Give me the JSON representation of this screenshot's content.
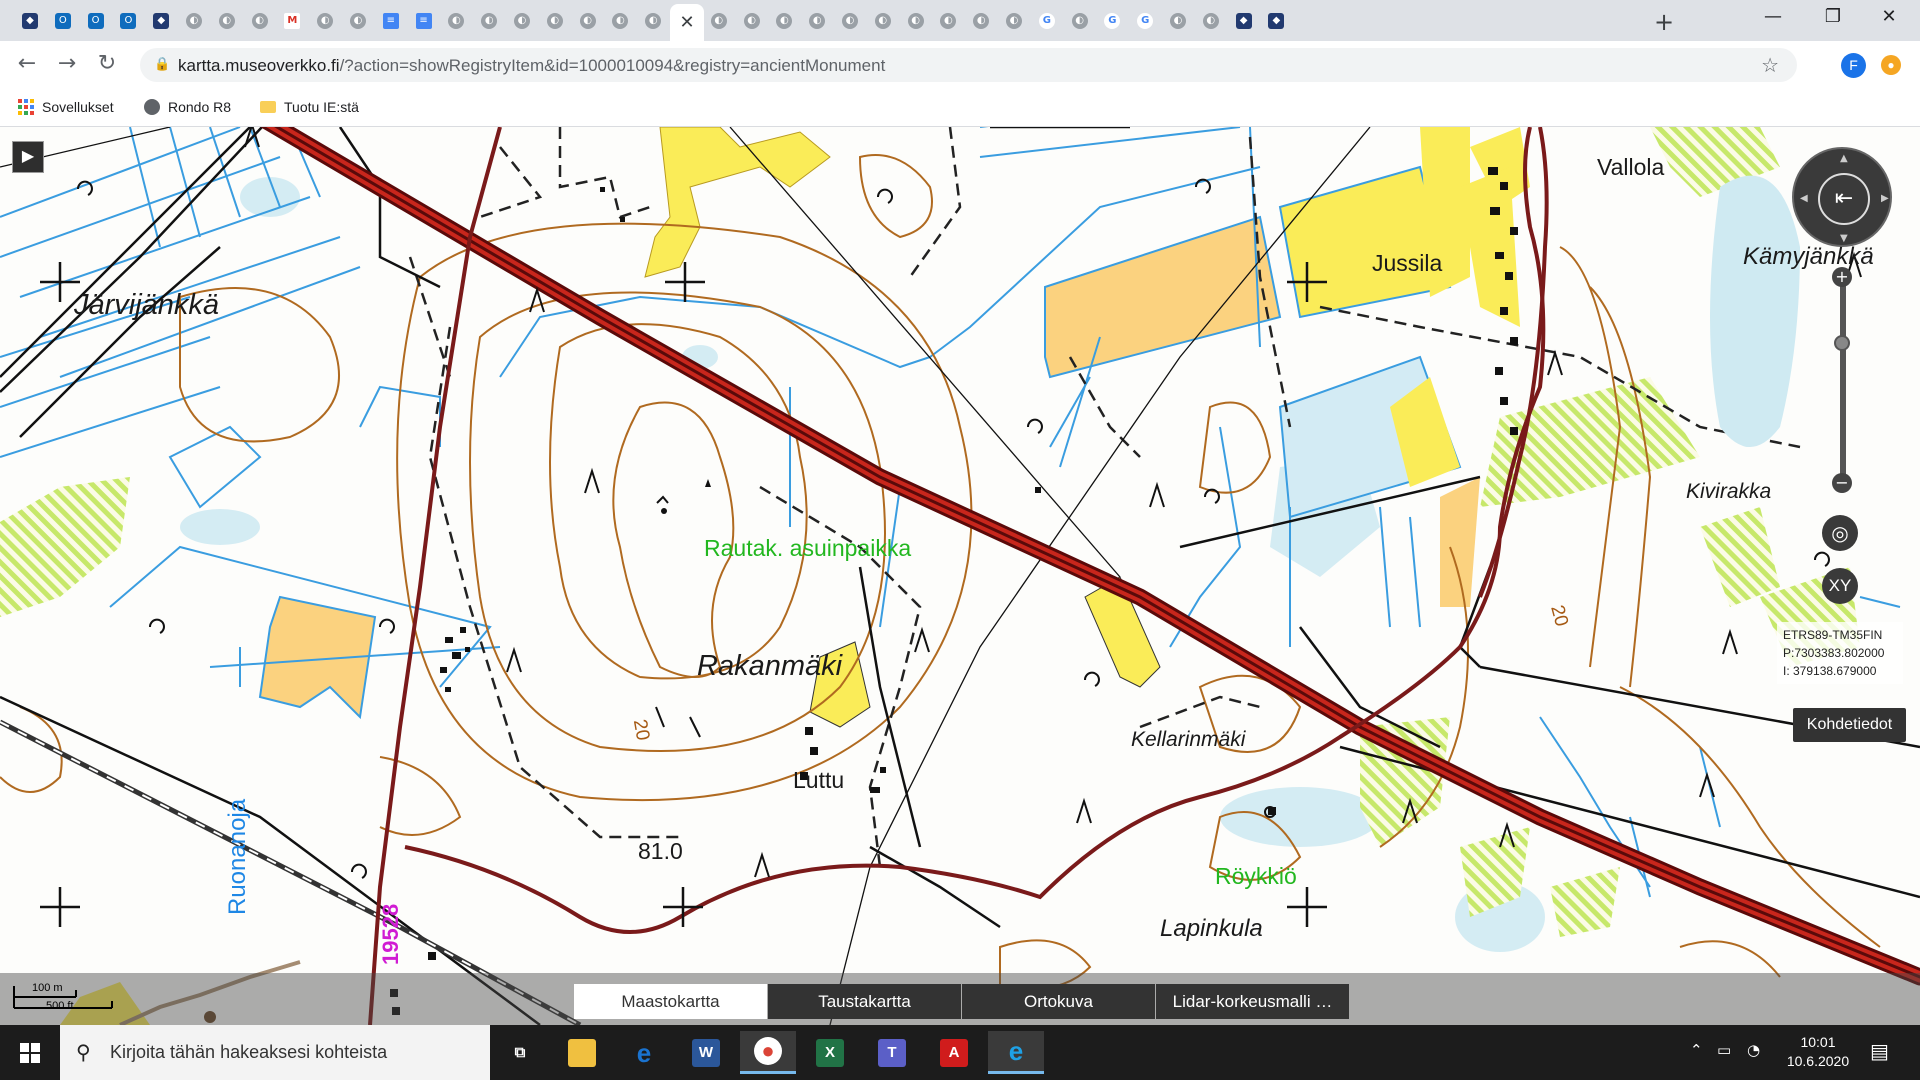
{
  "browser": {
    "tabs": [
      {
        "icon": "shield-icon",
        "type": "shield"
      },
      {
        "icon": "outlook-icon",
        "type": "outlook"
      },
      {
        "icon": "outlook-icon",
        "type": "outlook"
      },
      {
        "icon": "outlook-icon",
        "type": "outlook"
      },
      {
        "icon": "shield-icon",
        "type": "shield"
      },
      {
        "icon": "page-icon",
        "type": "sep"
      },
      {
        "icon": "page-icon",
        "type": "sep"
      },
      {
        "icon": "page-icon",
        "type": "sep"
      },
      {
        "icon": "gmail-icon",
        "type": "gmail"
      },
      {
        "icon": "page-icon",
        "type": "sep"
      },
      {
        "icon": "page-icon",
        "type": "sep"
      },
      {
        "icon": "docs-icon",
        "type": "docs"
      },
      {
        "icon": "docs-icon",
        "type": "docs"
      },
      {
        "icon": "page-icon",
        "type": "sep"
      },
      {
        "icon": "page-icon",
        "type": "sep"
      },
      {
        "icon": "page-icon",
        "type": "sep"
      },
      {
        "icon": "page-icon",
        "type": "sep"
      },
      {
        "icon": "page-icon",
        "type": "sep"
      },
      {
        "icon": "page-icon",
        "type": "sep"
      },
      {
        "icon": "page-icon",
        "type": "sep"
      },
      {
        "icon": "close-icon",
        "type": "active"
      },
      {
        "icon": "page-icon",
        "type": "sep"
      },
      {
        "icon": "page-icon",
        "type": "sep"
      },
      {
        "icon": "page-icon",
        "type": "sep"
      },
      {
        "icon": "page-icon",
        "type": "sep"
      },
      {
        "icon": "page-icon",
        "type": "sep"
      },
      {
        "icon": "page-icon",
        "type": "sep"
      },
      {
        "icon": "page-icon",
        "type": "sep"
      },
      {
        "icon": "page-icon",
        "type": "sep"
      },
      {
        "icon": "page-icon",
        "type": "sep"
      },
      {
        "icon": "page-icon",
        "type": "sep"
      },
      {
        "icon": "google-icon",
        "type": "google"
      },
      {
        "icon": "page-icon",
        "type": "sep"
      },
      {
        "icon": "google-icon",
        "type": "google"
      },
      {
        "icon": "google-icon",
        "type": "google"
      },
      {
        "icon": "mail-icon",
        "type": "sep"
      },
      {
        "icon": "chart-icon",
        "type": "sep"
      },
      {
        "icon": "shield-icon",
        "type": "shield"
      },
      {
        "icon": "shield-icon",
        "type": "shield"
      }
    ],
    "new_tab": "+",
    "window_controls": {
      "minimize": "—",
      "maximize": "❐",
      "close": "✕"
    },
    "url_host": "kartta.museoverkko.fi",
    "url_rest": "/?action=showRegistryItem&id=1000010094&registry=ancientMonument",
    "profile_initial": "F",
    "bookmarks": [
      {
        "label": "Sovellukset",
        "icon": "apps-icon"
      },
      {
        "label": "Rondo R8",
        "icon": "globe-icon"
      },
      {
        "label": "Tuotu IE:stä",
        "icon": "folder-icon"
      }
    ]
  },
  "map": {
    "place_names": {
      "jarvijankka": "Järvijänkkä",
      "rakanmaki": "Rakanmäki",
      "jussila": "Jussila",
      "vallola": "Vallola",
      "kamyjankka": "Kämyjänkkä",
      "kivirakka": "Kivirakka",
      "kellarinmaki": "Kellarinmäki",
      "lapinkula": "Lapinkula",
      "luttu": "Luttu"
    },
    "monument_label": "Rautak. asuinpaikka",
    "roykkio_label": "Röykkiö",
    "water_label": "Ruonanoja",
    "road_number": "19528",
    "elevation": "81.0",
    "contour_labels": [
      "20",
      "20"
    ],
    "controls": {
      "play": "▶",
      "compass": "⇤",
      "zoom_in": "+",
      "zoom_out": "−",
      "locate": "◎",
      "xy": "XY",
      "feature_info": "Kohdetiedot"
    },
    "coordinates": {
      "system": "ETRS89-TM35FIN",
      "north": "P:7303383.802000",
      "east": "I:   379138.679000"
    },
    "scale": {
      "top": "100 m",
      "bottom": "500 ft"
    },
    "layer_tabs": [
      {
        "label": "Maastokartta",
        "active": true
      },
      {
        "label": "Taustakartta",
        "active": false
      },
      {
        "label": "Ortokuva",
        "active": false
      },
      {
        "label": "Lidar-korkeusmalli …",
        "active": false
      }
    ]
  },
  "taskbar": {
    "search_placeholder": "Kirjoita tähän hakeaksesi kohteista",
    "apps": [
      {
        "name": "task-view-icon",
        "glyph": "⧉",
        "color": "transparent"
      },
      {
        "name": "file-explorer-icon",
        "glyph": "▬",
        "color": "#f0c040"
      },
      {
        "name": "edge-icon",
        "glyph": "e",
        "color": "#1a73d0"
      },
      {
        "name": "word-icon",
        "glyph": "W",
        "color": "#2b579a"
      },
      {
        "name": "chrome-icon",
        "glyph": "●",
        "color": "#db4437"
      },
      {
        "name": "excel-icon",
        "glyph": "X",
        "color": "#217346"
      },
      {
        "name": "teams-icon",
        "glyph": "T",
        "color": "#5b5fc7"
      },
      {
        "name": "acrobat-icon",
        "glyph": "A",
        "color": "#d01c1c"
      },
      {
        "name": "ie-icon",
        "glyph": "e",
        "color": "#1ea1e6"
      }
    ],
    "time": "10:01",
    "date": "10.6.2020"
  }
}
